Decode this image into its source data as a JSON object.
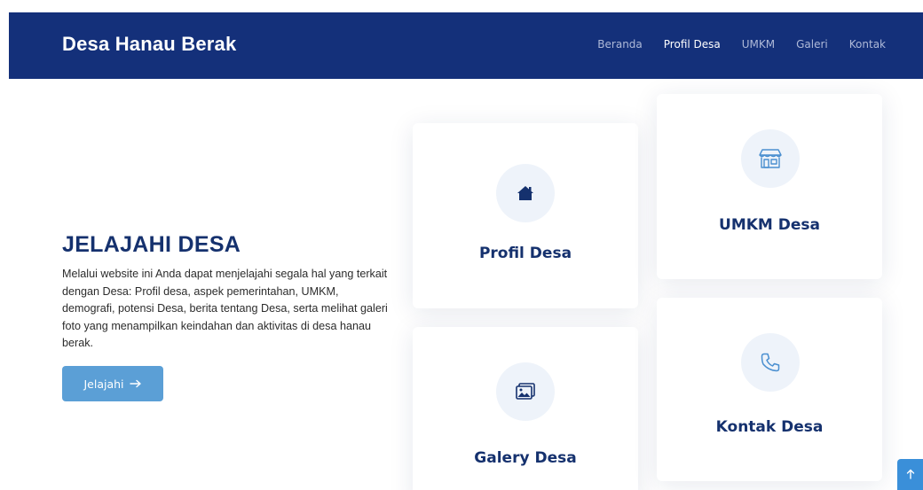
{
  "header": {
    "brand": "Desa Hanau Berak",
    "nav": [
      {
        "label": "Beranda",
        "active": false
      },
      {
        "label": "Profil Desa",
        "active": true
      },
      {
        "label": "UMKM",
        "active": false
      },
      {
        "label": "Galeri",
        "active": false
      },
      {
        "label": "Kontak",
        "active": false
      }
    ]
  },
  "hero": {
    "title": "JELAJAHI DESA",
    "description": "Melalui website ini Anda dapat menjelajahi segala hal yang terkait dengan Desa: Profil desa, aspek pemerintahan, UMKM, demografi, potensi Desa, berita tentang Desa, serta melihat galeri foto yang menampilkan keindahan dan aktivitas di desa hanau berak.",
    "button_label": "Jelajahi",
    "button_icon": "arrow-right-icon"
  },
  "cards": [
    {
      "label": "Profil Desa",
      "icon": "house-icon"
    },
    {
      "label": "UMKM Desa",
      "icon": "shop-icon"
    },
    {
      "label": "Galery Desa",
      "icon": "images-icon"
    },
    {
      "label": "Kontak Desa",
      "icon": "phone-icon"
    }
  ],
  "scroll_top_icon": "arrow-up-icon",
  "colors": {
    "navbar_bg": "#14307a",
    "accent": "#5b9fd6",
    "heading": "#15316e",
    "icon_bg": "#eef3fa",
    "scroll_top_bg": "#3a8fd9"
  }
}
